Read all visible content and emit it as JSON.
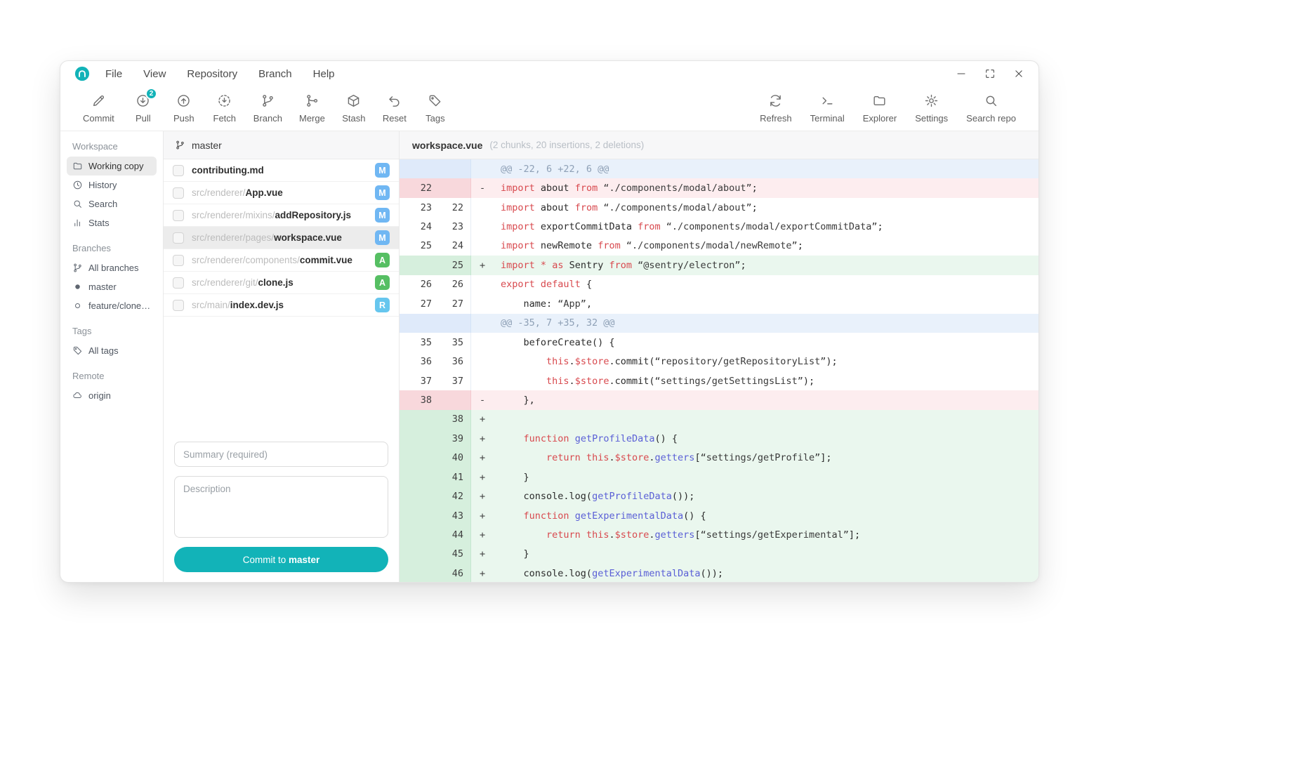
{
  "colors": {
    "accent": "#12b3b8",
    "badge_m": "#70b7f3",
    "badge_a": "#56bf63",
    "badge_r": "#66c6ee",
    "kw": "#d8494e",
    "ident": "#5a5fd6"
  },
  "menu": {
    "logo_icon": "app-logo-icon",
    "items": [
      "File",
      "View",
      "Repository",
      "Branch",
      "Help"
    ]
  },
  "window_controls": [
    {
      "id": "minimize",
      "icon": "minimize-icon"
    },
    {
      "id": "maximize",
      "icon": "maximize-icon"
    },
    {
      "id": "close",
      "icon": "close-icon"
    }
  ],
  "toolbar": {
    "left": [
      {
        "id": "commit",
        "label": "Commit",
        "icon": "pencil-icon"
      },
      {
        "id": "pull",
        "label": "Pull",
        "icon": "arrow-down-circle-icon",
        "badge": "2"
      },
      {
        "id": "push",
        "label": "Push",
        "icon": "arrow-up-circle-icon"
      },
      {
        "id": "fetch",
        "label": "Fetch",
        "icon": "fetch-icon"
      },
      {
        "id": "branch",
        "label": "Branch",
        "icon": "branch-icon"
      },
      {
        "id": "merge",
        "label": "Merge",
        "icon": "merge-icon"
      },
      {
        "id": "stash",
        "label": "Stash",
        "icon": "box-icon"
      },
      {
        "id": "reset",
        "label": "Reset",
        "icon": "undo-icon"
      },
      {
        "id": "tags",
        "label": "Tags",
        "icon": "tag-icon"
      }
    ],
    "right": [
      {
        "id": "refresh",
        "label": "Refresh",
        "icon": "refresh-icon"
      },
      {
        "id": "terminal",
        "label": "Terminal",
        "icon": "terminal-icon"
      },
      {
        "id": "explorer",
        "label": "Explorer",
        "icon": "folder-icon"
      },
      {
        "id": "settings",
        "label": "Settings",
        "icon": "gear-icon"
      },
      {
        "id": "search-repo",
        "label": "Search repo",
        "icon": "search-icon"
      }
    ]
  },
  "sidebar": {
    "sections": [
      {
        "title": "Workspace",
        "items": [
          {
            "id": "working-copy",
            "label": "Working copy",
            "icon": "folder-icon",
            "active": true
          },
          {
            "id": "history",
            "label": "History",
            "icon": "clock-icon"
          },
          {
            "id": "search",
            "label": "Search",
            "icon": "search-icon"
          },
          {
            "id": "stats",
            "label": "Stats",
            "icon": "stats-icon"
          }
        ]
      },
      {
        "title": "Branches",
        "items": [
          {
            "id": "all-branches",
            "label": "All branches",
            "icon": "branch-icon"
          },
          {
            "id": "branch-master",
            "label": "master",
            "icon": "dot-filled-icon"
          },
          {
            "id": "branch-feature",
            "label": "feature/clone-re...",
            "icon": "dot-open-icon"
          }
        ]
      },
      {
        "title": "Tags",
        "items": [
          {
            "id": "all-tags",
            "label": "All tags",
            "icon": "tag-icon"
          }
        ]
      },
      {
        "title": "Remote",
        "items": [
          {
            "id": "origin",
            "label": "origin",
            "icon": "cloud-icon"
          }
        ]
      }
    ]
  },
  "files": {
    "branch": "master",
    "branch_icon": "branch-icon",
    "rows": [
      {
        "prefix": "",
        "name": "contributing.md",
        "status": "M"
      },
      {
        "prefix": "src/renderer/",
        "name": "App.vue",
        "status": "M"
      },
      {
        "prefix": "src/renderer/mixins/",
        "name": "addRepository.js",
        "status": "M"
      },
      {
        "prefix": "src/renderer/pages/",
        "name": "workspace.vue",
        "status": "M",
        "selected": true
      },
      {
        "prefix": "src/renderer/components/",
        "name": "commit.vue",
        "status": "A"
      },
      {
        "prefix": "src/renderer/git/",
        "name": "clone.js",
        "status": "A"
      },
      {
        "prefix": "src/main/",
        "name": "index.dev.js",
        "status": "R"
      }
    ],
    "summary_placeholder": "Summary (required)",
    "description_placeholder": "Description",
    "commit_button": {
      "prefix": "Commit to ",
      "branch": "master"
    }
  },
  "diff": {
    "filename": "workspace.vue",
    "stats": "(2 chunks, 20 insertions, 2 deletions)",
    "lines": [
      {
        "type": "hunk",
        "text": "@@ -22, 6 +22, 6 @@"
      },
      {
        "type": "del",
        "old": "22",
        "sign": "-",
        "indent": 0,
        "tokens": [
          [
            "k",
            "import"
          ],
          [
            "p",
            " about "
          ],
          [
            "k",
            "from"
          ],
          [
            "p",
            " "
          ],
          [
            "s",
            "“./components/modal/about”"
          ],
          [
            "p",
            ";"
          ]
        ]
      },
      {
        "type": "ctx",
        "old": "23",
        "new": "22",
        "indent": 0,
        "tokens": [
          [
            "k",
            "import"
          ],
          [
            "p",
            " about "
          ],
          [
            "k",
            "from"
          ],
          [
            "p",
            " "
          ],
          [
            "s",
            "“./components/modal/about”"
          ],
          [
            "p",
            ";"
          ]
        ]
      },
      {
        "type": "ctx",
        "old": "24",
        "new": "23",
        "indent": 0,
        "tokens": [
          [
            "k",
            "import"
          ],
          [
            "p",
            " exportCommitData "
          ],
          [
            "k",
            "from"
          ],
          [
            "p",
            " "
          ],
          [
            "s",
            "“./components/modal/exportCommitData”"
          ],
          [
            "p",
            ";"
          ]
        ]
      },
      {
        "type": "ctx",
        "old": "25",
        "new": "24",
        "indent": 0,
        "tokens": [
          [
            "k",
            "import"
          ],
          [
            "p",
            " newRemote "
          ],
          [
            "k",
            "from"
          ],
          [
            "p",
            " "
          ],
          [
            "s",
            "“./components/modal/newRemote”"
          ],
          [
            "p",
            ";"
          ]
        ]
      },
      {
        "type": "add",
        "new": "25",
        "sign": "+",
        "indent": 0,
        "tokens": [
          [
            "k",
            "import"
          ],
          [
            "p",
            " "
          ],
          [
            "k",
            "*"
          ],
          [
            "p",
            " "
          ],
          [
            "k",
            "as"
          ],
          [
            "p",
            " Sentry "
          ],
          [
            "k",
            "from"
          ],
          [
            "p",
            " "
          ],
          [
            "s",
            "“@sentry/electron”"
          ],
          [
            "p",
            ";"
          ]
        ]
      },
      {
        "type": "ctx",
        "old": "26",
        "new": "26",
        "indent": 0,
        "tokens": [
          [
            "k",
            "export"
          ],
          [
            "p",
            " "
          ],
          [
            "k",
            "default"
          ],
          [
            "p",
            " {"
          ]
        ]
      },
      {
        "type": "ctx",
        "old": "27",
        "new": "27",
        "indent": 4,
        "tokens": [
          [
            "p",
            "name: "
          ],
          [
            "s",
            "“App”"
          ],
          [
            "p",
            ","
          ]
        ]
      },
      {
        "type": "hunk",
        "text": "@@ -35, 7 +35, 32 @@"
      },
      {
        "type": "ctx",
        "old": "35",
        "new": "35",
        "indent": 4,
        "tokens": [
          [
            "p",
            "beforeCreate() {"
          ]
        ]
      },
      {
        "type": "ctx",
        "old": "36",
        "new": "36",
        "indent": 8,
        "tokens": [
          [
            "k",
            "this"
          ],
          [
            "p",
            "."
          ],
          [
            "k",
            "$store"
          ],
          [
            "p",
            ".commit("
          ],
          [
            "s",
            "“repository/getRepositoryList”"
          ],
          [
            "p",
            ");"
          ]
        ]
      },
      {
        "type": "ctx",
        "old": "37",
        "new": "37",
        "indent": 8,
        "tokens": [
          [
            "k",
            "this"
          ],
          [
            "p",
            "."
          ],
          [
            "k",
            "$store"
          ],
          [
            "p",
            ".commit("
          ],
          [
            "s",
            "“settings/getSettingsList”"
          ],
          [
            "p",
            ");"
          ]
        ]
      },
      {
        "type": "del",
        "old": "38",
        "sign": "-",
        "indent": 4,
        "tokens": [
          [
            "p",
            "},"
          ]
        ]
      },
      {
        "type": "add",
        "new": "38",
        "sign": "+",
        "indent": 0,
        "tokens": []
      },
      {
        "type": "add",
        "new": "39",
        "sign": "+",
        "indent": 4,
        "tokens": [
          [
            "k",
            "function"
          ],
          [
            "p",
            " "
          ],
          [
            "i",
            "getProfileData"
          ],
          [
            "p",
            "() {"
          ]
        ]
      },
      {
        "type": "add",
        "new": "40",
        "sign": "+",
        "indent": 8,
        "tokens": [
          [
            "k",
            "return"
          ],
          [
            "p",
            " "
          ],
          [
            "k",
            "this"
          ],
          [
            "p",
            "."
          ],
          [
            "k",
            "$store"
          ],
          [
            "p",
            "."
          ],
          [
            "i",
            "getters"
          ],
          [
            "p",
            "["
          ],
          [
            "s",
            "“settings/getProfile”"
          ],
          [
            "p",
            "];"
          ]
        ]
      },
      {
        "type": "add",
        "new": "41",
        "sign": "+",
        "indent": 4,
        "tokens": [
          [
            "p",
            "}"
          ]
        ]
      },
      {
        "type": "add",
        "new": "42",
        "sign": "+",
        "indent": 4,
        "tokens": [
          [
            "p",
            "console.log("
          ],
          [
            "i",
            "getProfileData"
          ],
          [
            "p",
            "());"
          ]
        ]
      },
      {
        "type": "add",
        "new": "43",
        "sign": "+",
        "indent": 4,
        "tokens": [
          [
            "k",
            "function"
          ],
          [
            "p",
            " "
          ],
          [
            "i",
            "getExperimentalData"
          ],
          [
            "p",
            "() {"
          ]
        ]
      },
      {
        "type": "add",
        "new": "44",
        "sign": "+",
        "indent": 8,
        "tokens": [
          [
            "k",
            "return"
          ],
          [
            "p",
            " "
          ],
          [
            "k",
            "this"
          ],
          [
            "p",
            "."
          ],
          [
            "k",
            "$store"
          ],
          [
            "p",
            "."
          ],
          [
            "i",
            "getters"
          ],
          [
            "p",
            "["
          ],
          [
            "s",
            "“settings/getExperimental”"
          ],
          [
            "p",
            "];"
          ]
        ]
      },
      {
        "type": "add",
        "new": "45",
        "sign": "+",
        "indent": 4,
        "tokens": [
          [
            "p",
            "}"
          ]
        ]
      },
      {
        "type": "add",
        "new": "46",
        "sign": "+",
        "indent": 4,
        "tokens": [
          [
            "p",
            "console.log("
          ],
          [
            "i",
            "getExperimentalData"
          ],
          [
            "p",
            "());"
          ]
        ]
      }
    ]
  }
}
